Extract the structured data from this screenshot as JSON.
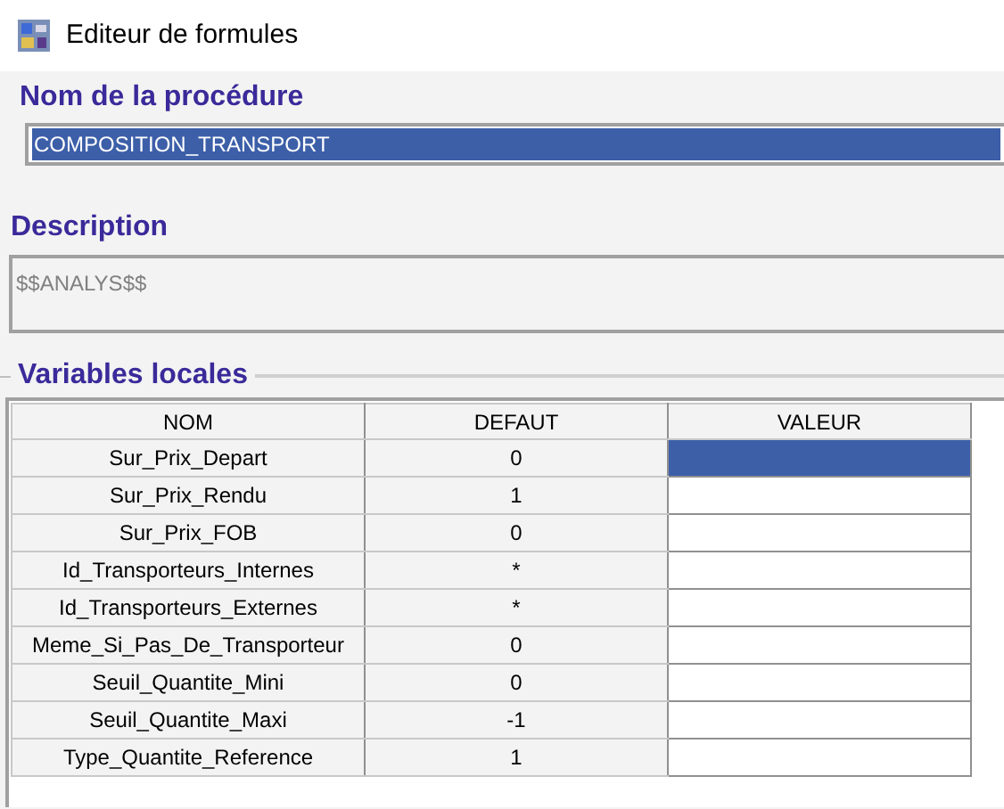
{
  "window": {
    "title": "Editeur de formules"
  },
  "procedure": {
    "label": "Nom de la procédure",
    "value": "COMPOSITION_TRANSPORT",
    "selected": true
  },
  "description": {
    "label": "Description",
    "value": "$$ANALYS$$"
  },
  "variables": {
    "title": "Variables locales",
    "columns": [
      "NOM",
      "DEFAUT",
      "VALEUR"
    ],
    "rows": [
      {
        "nom": "Sur_Prix_Depart",
        "defaut": "0",
        "selected": true
      },
      {
        "nom": "Sur_Prix_Rendu",
        "defaut": "1",
        "selected": false
      },
      {
        "nom": "Sur_Prix_FOB",
        "defaut": "0",
        "selected": false
      },
      {
        "nom": "Id_Transporteurs_Internes",
        "defaut": "*",
        "selected": false
      },
      {
        "nom": "Id_Transporteurs_Externes",
        "defaut": "*",
        "selected": false
      },
      {
        "nom": "Meme_Si_Pas_De_Transporteur",
        "defaut": "0",
        "selected": false
      },
      {
        "nom": "Seuil_Quantite_Mini",
        "defaut": "0",
        "selected": false
      },
      {
        "nom": "Seuil_Quantite_Maxi",
        "defaut": "-1",
        "selected": false
      },
      {
        "nom": "Type_Quantite_Reference",
        "defaut": "1",
        "selected": false
      }
    ]
  }
}
